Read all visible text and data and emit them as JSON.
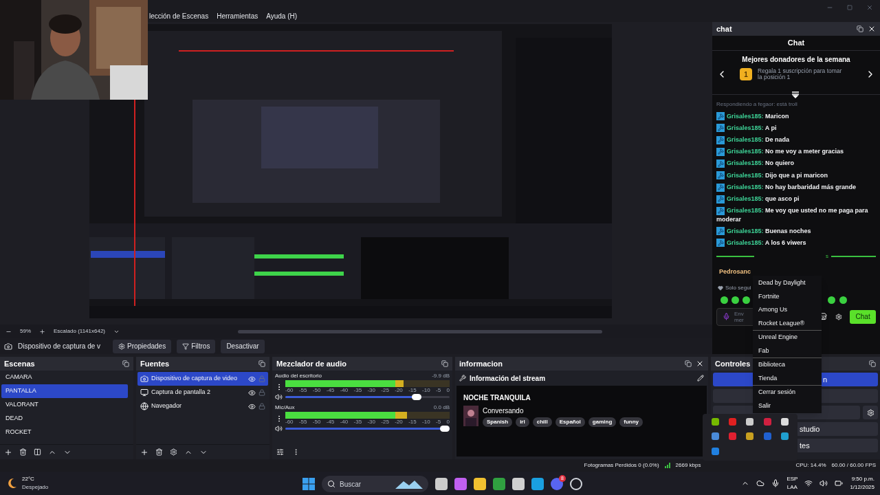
{
  "menu": [
    "lección de Escenas",
    "Herramientas",
    "Ayuda (H)"
  ],
  "webcam": {
    "kind": "picture"
  },
  "preview": {
    "kind": "picture",
    "zoom": "59%",
    "scale_mode": "Escalado (1141x642)"
  },
  "source_toolbar": {
    "source": "Dispositivo de captura de v",
    "buttons": [
      "Propiedades",
      "Filtros",
      "Desactivar"
    ]
  },
  "scenes": {
    "title": "Escenas",
    "items": [
      {
        "name": "CAMARA",
        "selected": false
      },
      {
        "name": "PANTALLA",
        "selected": true
      },
      {
        "name": "VALORANT",
        "selected": false
      },
      {
        "name": "DEAD",
        "selected": false
      },
      {
        "name": "ROCKET",
        "selected": false
      }
    ]
  },
  "sources": {
    "title": "Fuentes",
    "items": [
      {
        "name": "Dispositivo de captura de video",
        "kind": "camera",
        "selected": true,
        "visible": true
      },
      {
        "name": "Captura de pantalla 2",
        "kind": "screen",
        "selected": false,
        "visible": true
      },
      {
        "name": "Navegador",
        "kind": "browser",
        "selected": false,
        "visible": true
      }
    ]
  },
  "mixer": {
    "title": "Mezclador de audio",
    "tracks": [
      {
        "name": "Audio del escritorio",
        "reading": "-9.9 dB",
        "meter": {
          "level": 0.72
        },
        "scale": [
          "-60",
          "-55",
          "-50",
          "-45",
          "-40",
          "-35",
          "-30",
          "-25",
          "-20",
          "-15",
          "-10",
          "-5",
          "0"
        ],
        "volume": {
          "level": 0.83
        }
      },
      {
        "name": "Mic/Aux",
        "reading": "0.0 dB",
        "meter": {
          "level": 0.74
        },
        "scale": [
          "-60",
          "-55",
          "-50",
          "-45",
          "-40",
          "-35",
          "-30",
          "-25",
          "-20",
          "-15",
          "-10",
          "-5",
          "0"
        ],
        "volume": {
          "level": 1
        }
      }
    ]
  },
  "info": {
    "title": "informacion",
    "heading": "Información del stream",
    "stream_title": "NOCHE TRANQUILA",
    "category": "Conversando",
    "tags": [
      "Spanish",
      "irl",
      "chill",
      "Español",
      "gaming",
      "funny"
    ]
  },
  "controls": {
    "title": "Controles",
    "buttons": [
      {
        "kind": "primary",
        "label": "n"
      },
      {
        "kind": "plain"
      },
      {
        "kind": "settings"
      },
      {
        "kind": "plain",
        "label": "studio"
      },
      {
        "kind": "plain",
        "label": "tes"
      }
    ]
  },
  "chat": {
    "dock_title": "chat",
    "title": "Chat",
    "donors": {
      "title": "Mejores donadores de la semana",
      "rank": "1",
      "text": "Regala 1 suscripción para tomar la posición 1"
    },
    "reply": "Respondiendo a fegaor: está troll",
    "messages": [
      {
        "user": "Grisales185:",
        "text": "Maricon"
      },
      {
        "user": "Grisales185:",
        "text": "A pi"
      },
      {
        "user": "Grisales185:",
        "text": "De nada"
      },
      {
        "user": "Grisales185:",
        "text": "No me voy a meter gracias"
      },
      {
        "user": "Grisales185:",
        "text": "No quiero"
      },
      {
        "user": "Grisales185:",
        "text": "Dijo que a pi maricon"
      },
      {
        "user": "Grisales185:",
        "text": "No hay barbaridad más grande"
      },
      {
        "user": "Grisales185:",
        "text": "que asco pi"
      },
      {
        "user": "Grisales185:",
        "text": "Me voy que usted no me paga para moderar"
      },
      {
        "user": "Grisales185:",
        "text": "Buenas noches"
      },
      {
        "user": "Grisales185:",
        "text": "A los 6 viwers"
      }
    ],
    "divider_label": "s",
    "pinned_user": "Pedrosanc",
    "followers_note": "Solo segui",
    "input_lines": [
      "Env",
      "mer"
    ],
    "send": "Chat"
  },
  "context_menu": {
    "groups": [
      [
        "Dead by Daylight",
        "Fortnite",
        "Among Us",
        "Rocket League®"
      ],
      [
        "Unreal Engine",
        "Fab"
      ],
      [
        "Biblioteca",
        "Tienda"
      ],
      [
        "Cerrar sesión",
        "Salir"
      ]
    ]
  },
  "status": {
    "dropped": "Fotogramas Perdidos 0 (0.0%)",
    "bitrate": "2669 kbps",
    "cpu": "CPU: 14.4%",
    "fps": "60.00 / 60.00 FPS"
  },
  "taskbar": {
    "temp": "22°C",
    "weather": "Despejado",
    "search": "Buscar",
    "discord_badge": "8",
    "lang": "ESP",
    "layout": "LAA",
    "time": "9:50 p.m.",
    "date": "1/12/2025"
  }
}
